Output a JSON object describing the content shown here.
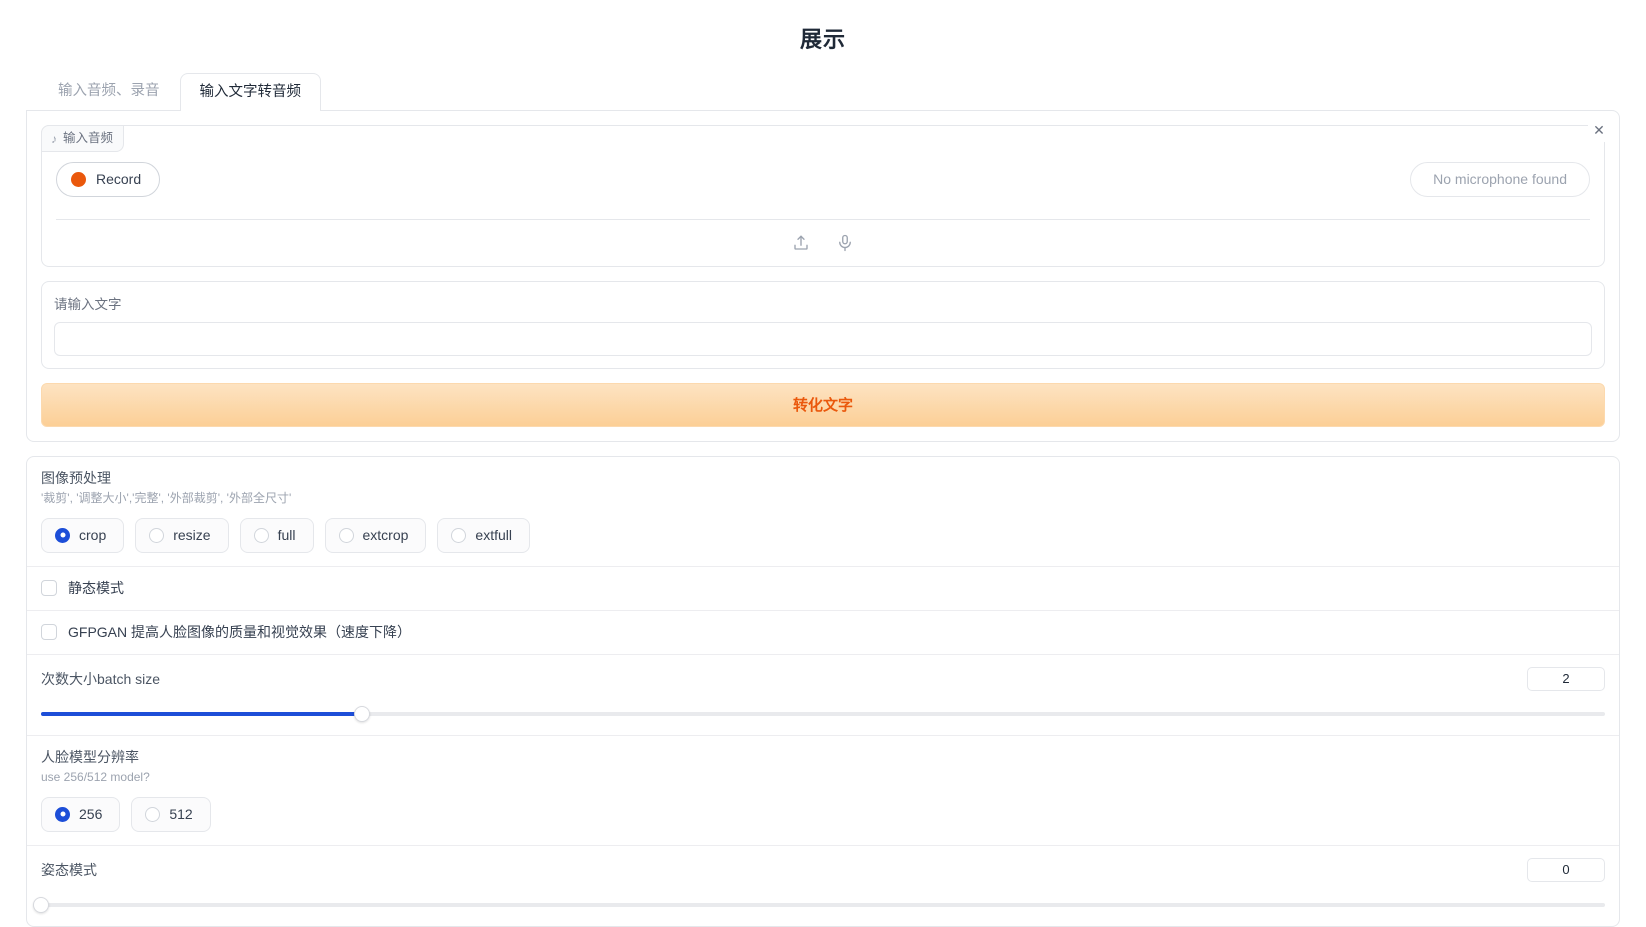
{
  "page": {
    "title": "展示"
  },
  "tabs": [
    {
      "label": "输入音频、录音",
      "active": false
    },
    {
      "label": "输入文字转音频",
      "active": true
    }
  ],
  "audio": {
    "tag_label": "输入音频",
    "music_icon": "music-note-icon",
    "record_label": "Record",
    "mic_status": "No microphone found",
    "upload_icon": "upload-icon",
    "mic_icon": "microphone-icon",
    "close_icon": "✕"
  },
  "text_input": {
    "label": "请输入文字",
    "value": "",
    "placeholder": ""
  },
  "submit": {
    "label": "转化文字",
    "accent_color": "#ea580c",
    "bg_start": "#fde3c2",
    "bg_end": "#fccf96"
  },
  "settings": {
    "preprocess": {
      "title": "图像预处理",
      "desc": "'裁剪', '调整大小','完整', '外部裁剪', '外部全尺寸'",
      "options": [
        {
          "label": "crop",
          "checked": true
        },
        {
          "label": "resize",
          "checked": false
        },
        {
          "label": "full",
          "checked": false
        },
        {
          "label": "extcrop",
          "checked": false
        },
        {
          "label": "extfull",
          "checked": false
        }
      ]
    },
    "still_mode": {
      "label": "静态模式",
      "checked": false
    },
    "gfpgan": {
      "label": "GFPGAN 提高人脸图像的质量和视觉效果（速度下降）",
      "checked": false
    },
    "batch_size": {
      "label": "次数大小batch size",
      "value": "2",
      "percent": 20.5,
      "fill_color": "#1d4ed8"
    },
    "face_resolution": {
      "title": "人脸模型分辨率",
      "desc": "use 256/512 model?",
      "options": [
        {
          "label": "256",
          "checked": true
        },
        {
          "label": "512",
          "checked": false
        }
      ]
    },
    "pose_style": {
      "label": "姿态模式",
      "value": "0",
      "percent": 0,
      "fill_color": "#1d4ed8"
    }
  }
}
